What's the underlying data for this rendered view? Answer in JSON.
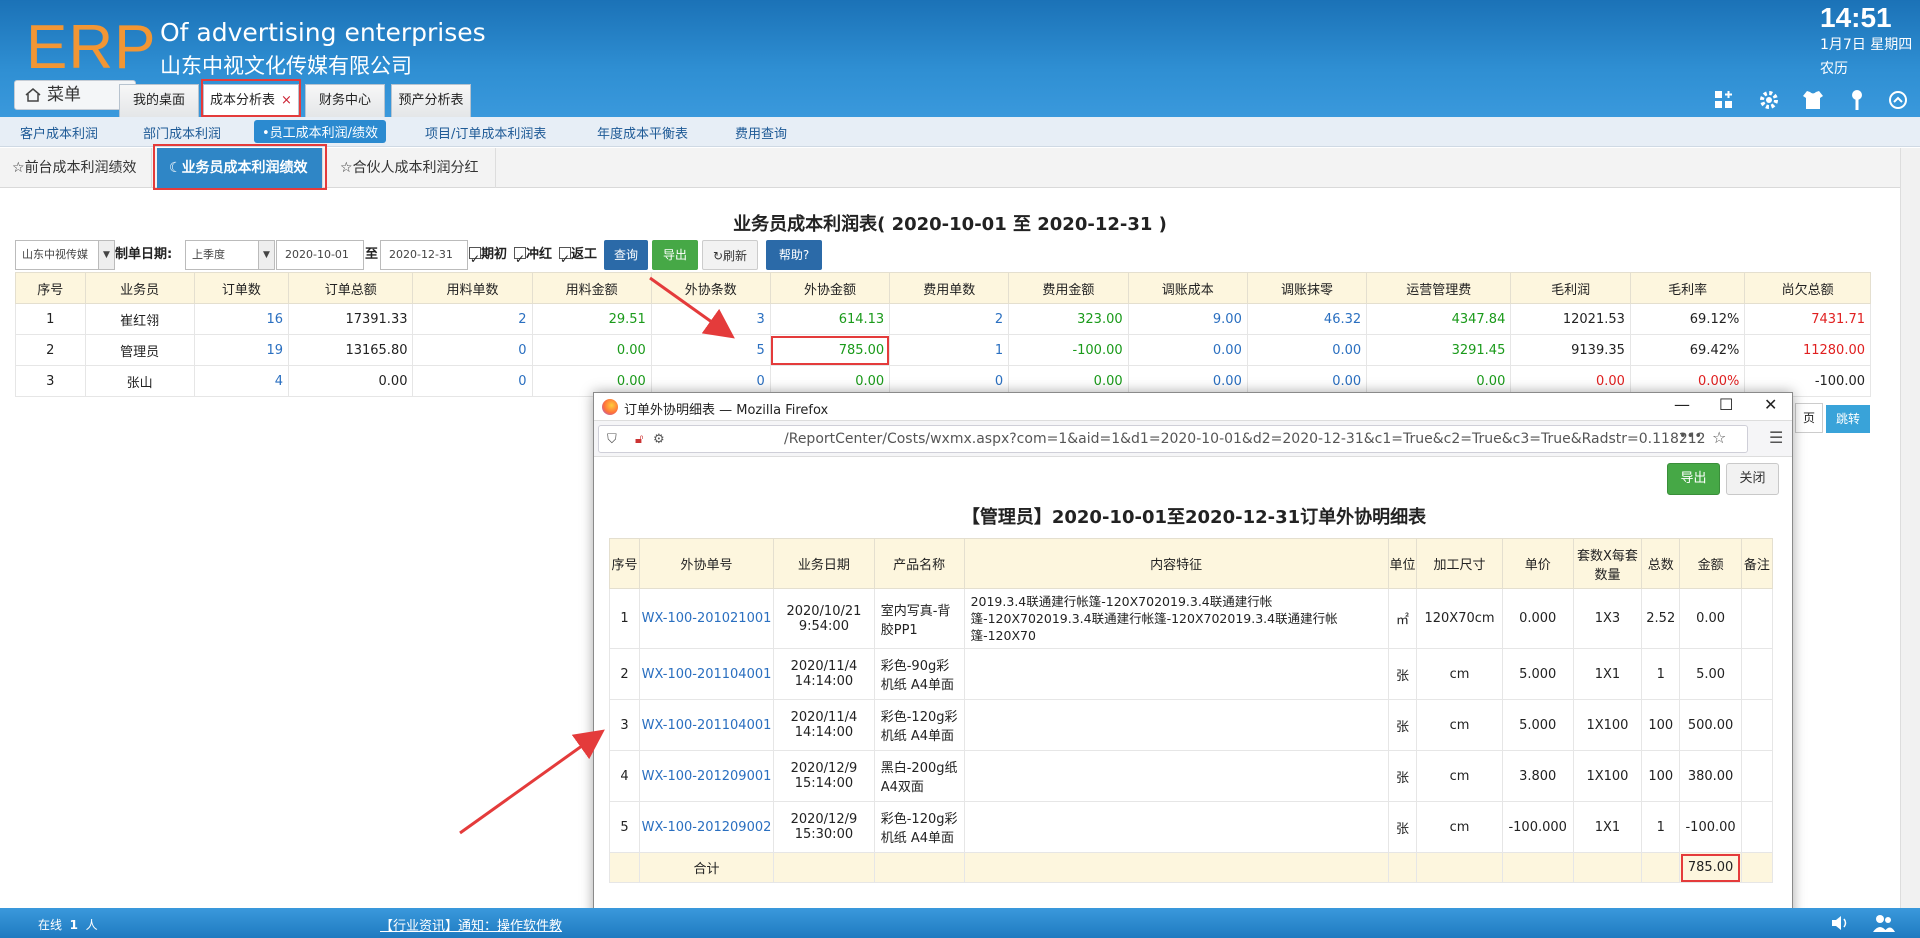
{
  "header": {
    "logo": "ERP",
    "company_en": "Of advertising enterprises",
    "company_cn": "山东中视文化传媒有限公司",
    "clock": "14:51",
    "date": "1月7日 星期四",
    "lunar": "农历",
    "menu_label": "菜单",
    "tabs": [
      {
        "label": "我的桌面"
      },
      {
        "label": "成本分析表",
        "close": "×"
      },
      {
        "label": "财务中心"
      },
      {
        "label": "预产分析表"
      }
    ]
  },
  "subnav": [
    "客户成本利润",
    "部门成本利润",
    "•员工成本利润/绩效",
    "项目/订单成本利润表",
    "年度成本平衡表",
    "费用查询"
  ],
  "tabs3": [
    "前台成本利润绩效",
    "业务员成本利润绩效",
    "合伙人成本利润分红"
  ],
  "report": {
    "title": "业务员成本利润表( 2020-10-01 至 2020-12-31 )",
    "filters": {
      "company": "山东中视传媒",
      "date_label": "制单日期:",
      "period": "上季度",
      "from": "2020-10-01",
      "to_label": "至",
      "to": "2020-12-31",
      "checks": [
        "期初",
        "冲红",
        "返工"
      ],
      "buttons": {
        "query": "查询",
        "export": "导出",
        "refresh": "刷新",
        "help": "帮助?"
      }
    },
    "columns": [
      "序号",
      "业务员",
      "订单数",
      "订单总额",
      "用料单数",
      "用料金额",
      "外协条数",
      "外协金额",
      "费用单数",
      "费用金额",
      "调账成本",
      "调账抹零",
      "运营管理费",
      "毛利润",
      "毛利率",
      "尚欠总额"
    ],
    "rows": [
      [
        "1",
        "崔红翎",
        "16",
        "17391.33",
        "2",
        "29.51",
        "3",
        "614.13",
        "2",
        "323.00",
        "9.00",
        "46.32",
        "4347.84",
        "12021.53",
        "69.12%",
        "7431.71"
      ],
      [
        "2",
        "管理员",
        "19",
        "13165.80",
        "0",
        "0.00",
        "5",
        "785.00",
        "1",
        "-100.00",
        "0.00",
        "0.00",
        "3291.45",
        "9139.35",
        "69.42%",
        "11280.00"
      ],
      [
        "3",
        "张山",
        "4",
        "0.00",
        "0",
        "0.00",
        "0",
        "0.00",
        "0",
        "0.00",
        "0.00",
        "0.00",
        "0.00",
        "0.00",
        "0.00%",
        "-100.00"
      ]
    ],
    "pager": {
      "page_suffix": "页",
      "jump": "跳转"
    }
  },
  "popup": {
    "window_title": "订单外协明细表 — Mozilla Firefox",
    "url": "/ReportCenter/Costs/wxmx.aspx?com=1&aid=1&d1=2020-10-01&d2=2020-12-31&c1=True&c2=True&c3=True&Radstr=0.118212",
    "export": "导出",
    "close": "关闭",
    "title": "【管理员】2020-10-01至2020-12-31订单外协明细表",
    "columns": [
      "序号",
      "外协单号",
      "业务日期",
      "产品名称",
      "内容特征",
      "单位",
      "加工尺寸",
      "单价",
      "套数X每套数量",
      "总数",
      "金额",
      "备注"
    ],
    "rows": [
      [
        "1",
        "WX-100-201021001",
        "2020/10/21 9:54:00",
        "室内写真-背胶PP1",
        "2019.3.4联通建行帐篷-120X702019.3.4联通建行帐篷-120X702019.3.4联通建行帐篷-120X702019.3.4联通建行帐篷-120X70",
        "㎡",
        "120X70cm",
        "0.000",
        "1X3",
        "2.52",
        "0.00",
        ""
      ],
      [
        "2",
        "WX-100-201104001",
        "2020/11/4 14:14:00",
        "彩色-90g彩机纸 A4单面",
        "",
        "张",
        "cm",
        "5.000",
        "1X1",
        "1",
        "5.00",
        ""
      ],
      [
        "3",
        "WX-100-201104001",
        "2020/11/4 14:14:00",
        "彩色-120g彩机纸 A4单面",
        "",
        "张",
        "cm",
        "5.000",
        "1X100",
        "100",
        "500.00",
        ""
      ],
      [
        "4",
        "WX-100-201209001",
        "2020/12/9 15:14:00",
        "黑白-200g纸 A4双面",
        "",
        "张",
        "cm",
        "3.800",
        "1X100",
        "100",
        "380.00",
        ""
      ],
      [
        "5",
        "WX-100-201209002",
        "2020/12/9 15:30:00",
        "彩色-120g彩机纸 A4单面",
        "",
        "张",
        "cm",
        "-100.000",
        "1X1",
        "1",
        "-100.00",
        ""
      ]
    ],
    "total_label": "合计",
    "total_value": "785.00"
  },
  "status": {
    "online_prefix": "在线",
    "online_count": "1",
    "online_suffix": "人",
    "news": "【行业资讯】通知：操作软件教"
  },
  "colors": {
    "brand": "#2f8fd3",
    "logo": "#f29634",
    "highlight": "#e43b3b",
    "link": "#2a6fc0",
    "positive": "#1a9a1a",
    "negative": "#e02020"
  }
}
